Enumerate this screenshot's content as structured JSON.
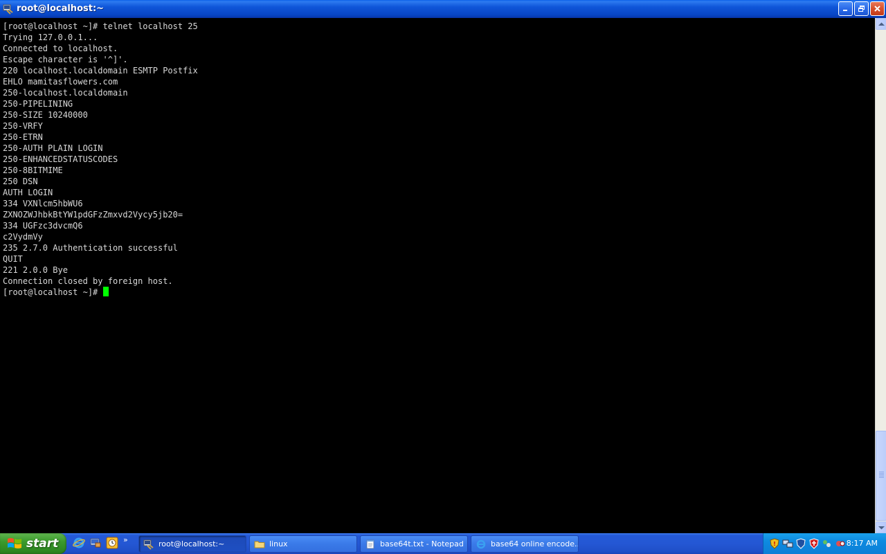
{
  "window": {
    "title": "root@localhost:~"
  },
  "terminal": {
    "lines": [
      "[root@localhost ~]# telnet localhost 25",
      "Trying 127.0.0.1...",
      "Connected to localhost.",
      "Escape character is '^]'.",
      "220 localhost.localdomain ESMTP Postfix",
      "EHLO mamitasflowers.com",
      "250-localhost.localdomain",
      "250-PIPELINING",
      "250-SIZE 10240000",
      "250-VRFY",
      "250-ETRN",
      "250-AUTH PLAIN LOGIN",
      "250-ENHANCEDSTATUSCODES",
      "250-8BITMIME",
      "250 DSN",
      "AUTH LOGIN",
      "334 VXNlcm5hbWU6",
      "ZXNOZWJhbkBtYW1pdGFzZmxvd2Vycy5jb20=",
      "334 UGFzc3dvcmQ6",
      "c2VydmVy",
      "235 2.7.0 Authentication successful",
      "QUIT",
      "221 2.0.0 Bye",
      "Connection closed by foreign host."
    ],
    "prompt": "[root@localhost ~]# ",
    "cursor_color": "#00ff00",
    "text_color": "#d8d8d8"
  },
  "taskbar": {
    "start_label": "start",
    "quicklaunch_more": "»",
    "tasks": [
      {
        "label": "root@localhost:~",
        "icon": "terminal-icon",
        "active": true
      },
      {
        "label": "linux",
        "icon": "folder-icon",
        "active": false
      },
      {
        "label": "base64t.txt - Notepad",
        "icon": "notepad-icon",
        "active": false
      },
      {
        "label": "base64 online encode...",
        "icon": "ie-icon",
        "active": false
      }
    ],
    "clock": "8:17 AM"
  },
  "colors": {
    "titlebar": "#0846c6",
    "taskbar": "#2457d4",
    "start": "#3b9a2c",
    "tray": "#0e8ae0"
  }
}
